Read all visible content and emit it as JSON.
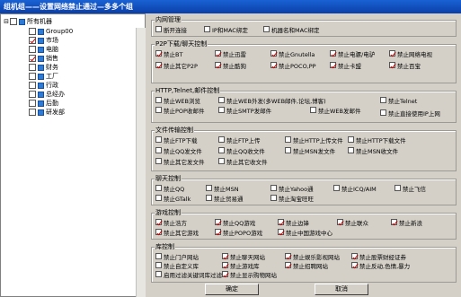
{
  "window": {
    "title": "组机组——设置网络禁止通过—多多个组"
  },
  "tree": {
    "root": "所有机器",
    "items": [
      {
        "label": "Group00",
        "checked": false
      },
      {
        "label": "市场",
        "checked": true
      },
      {
        "label": "电脑",
        "checked": false
      },
      {
        "label": "销售",
        "checked": true
      },
      {
        "label": "财务",
        "checked": false
      },
      {
        "label": "工厂",
        "checked": false
      },
      {
        "label": "行政",
        "checked": false
      },
      {
        "label": "总经办",
        "checked": false
      },
      {
        "label": "后勤",
        "checked": false
      },
      {
        "label": "研发部",
        "checked": false
      }
    ]
  },
  "groups": {
    "network": {
      "title": "内网管理",
      "options": [
        {
          "label": "断开连接",
          "checked": false
        },
        {
          "label": "IP和MAC绑定",
          "checked": false
        },
        {
          "label": "机器名和MAC绑定",
          "checked": false
        }
      ]
    },
    "p2p": {
      "title": "P2P下载/聊天控制",
      "options": [
        {
          "label": "禁止BT",
          "checked": true
        },
        {
          "label": "禁止迅雷",
          "checked": true
        },
        {
          "label": "禁止Gnutella",
          "checked": true
        },
        {
          "label": "禁止电骡/电驴",
          "checked": true
        },
        {
          "label": "禁止网络电视",
          "checked": true
        },
        {
          "label": "禁止其它P2P",
          "checked": true
        },
        {
          "label": "禁止酷狗",
          "checked": true
        },
        {
          "label": "禁止POCO,PP",
          "checked": true
        },
        {
          "label": "禁止卡盟",
          "checked": true
        },
        {
          "label": "禁止百宝",
          "checked": true
        }
      ]
    },
    "http": {
      "title": "HTTP,Telnet,邮件控制",
      "options": [
        {
          "label": "禁止WEB浏览",
          "checked": false
        },
        {
          "label": "禁止WEB外发(多WEB邮件,论坛,博客)",
          "checked": false
        },
        {
          "label": "禁止Telnet",
          "checked": false
        },
        {
          "label": "禁止POP收邮件",
          "checked": false
        },
        {
          "label": "禁止SMTP发邮件",
          "checked": false
        },
        {
          "label": "禁止WEB发邮件",
          "checked": false
        },
        {
          "label": "禁止直接使用IP上网",
          "checked": false
        }
      ]
    },
    "file": {
      "title": "文件传输控制",
      "options": [
        {
          "label": "禁止FTP下载",
          "checked": false
        },
        {
          "label": "禁止FTP上传",
          "checked": false
        },
        {
          "label": "禁止HTTP上传文件",
          "checked": false
        },
        {
          "label": "禁止HTTP下载文件",
          "checked": false
        },
        {
          "label": "禁止QQ发文件",
          "checked": false
        },
        {
          "label": "禁止QQ收文件",
          "checked": false
        },
        {
          "label": "禁止MSN发文件",
          "checked": false
        },
        {
          "label": "禁止MSN收文件",
          "checked": false
        },
        {
          "label": "禁止其它发文件",
          "checked": false
        },
        {
          "label": "禁止其它收文件",
          "checked": false
        }
      ]
    },
    "chat": {
      "title": "聊天控制",
      "options": [
        {
          "label": "禁止QQ",
          "checked": false
        },
        {
          "label": "禁止MSN",
          "checked": false
        },
        {
          "label": "禁止Yahoo通",
          "checked": false
        },
        {
          "label": "禁止ICQ/AIM",
          "checked": false
        },
        {
          "label": "禁止飞信",
          "checked": false
        },
        {
          "label": "禁止GTalk",
          "checked": false
        },
        {
          "label": "禁止贸易通",
          "checked": false
        },
        {
          "label": "禁止淘宝旺旺",
          "checked": false
        }
      ]
    },
    "game": {
      "title": "游戏控制",
      "options": [
        {
          "label": "禁止浩方",
          "checked": true
        },
        {
          "label": "禁止QQ游戏",
          "checked": true
        },
        {
          "label": "禁止边锋",
          "checked": true
        },
        {
          "label": "禁止联众",
          "checked": true
        },
        {
          "label": "禁止新浪",
          "checked": true
        },
        {
          "label": "禁止其它游戏",
          "checked": true
        },
        {
          "label": "禁止POPO游戏",
          "checked": true
        },
        {
          "label": "禁止中国游戏中心",
          "checked": true
        }
      ]
    },
    "lib": {
      "title": "库控制",
      "options": [
        {
          "label": "禁止门户网站",
          "checked": false
        },
        {
          "label": "禁止聊天网站",
          "checked": true
        },
        {
          "label": "禁止娱乐影视网站",
          "checked": true
        },
        {
          "label": "禁止股票财经证券",
          "checked": true
        },
        {
          "label": "禁止自定义库",
          "checked": false
        },
        {
          "label": "禁止游戏库",
          "checked": true
        },
        {
          "label": "禁止招聘网站",
          "checked": true
        },
        {
          "label": "禁止反动,色情,暴力",
          "checked": true
        },
        {
          "label": "启用过滤关键词库过滤",
          "checked": false
        },
        {
          "label": "禁止显示购物网站",
          "checked": true
        }
      ]
    }
  },
  "buttons": {
    "ok": "确定",
    "cancel": "取消"
  }
}
